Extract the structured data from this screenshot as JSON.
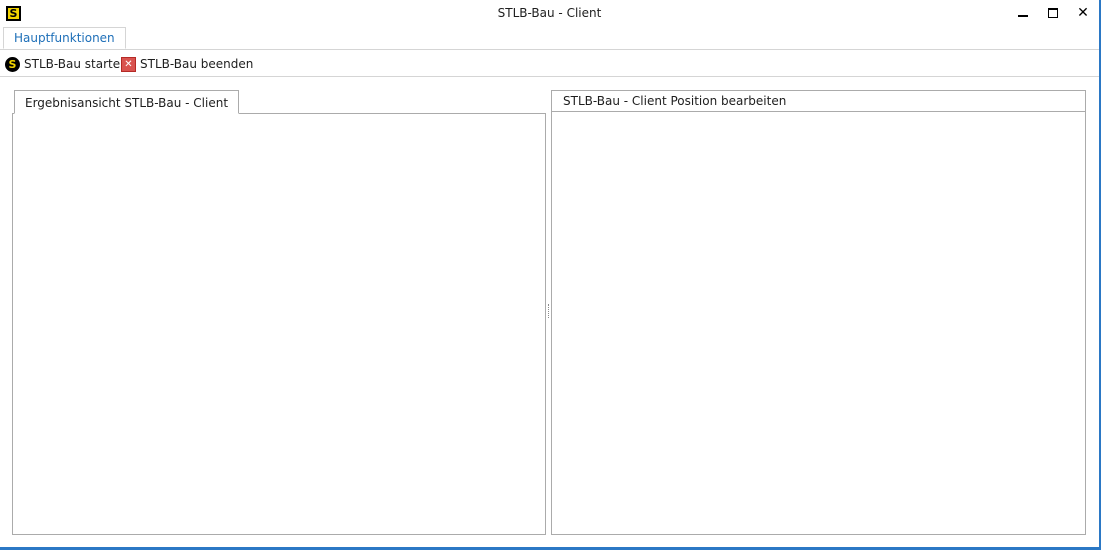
{
  "window": {
    "title": "STLB-Bau - Client",
    "app_icon_letter": "S",
    "controls": {
      "minimize": "minimize-icon",
      "maximize": "maximize-icon",
      "close": "close-icon"
    },
    "accent_color": "#2b78c5"
  },
  "ribbon": {
    "tabs": [
      {
        "label": "Hauptfunktionen",
        "selected": true
      }
    ],
    "toolbar": {
      "start_label": "STLB-Bau starten",
      "start_icon": "stlb-start-icon",
      "stop_label": "STLB-Bau beenden",
      "stop_icon": "stop-icon"
    }
  },
  "left_pane": {
    "tab_label": "Ergebnisansicht STLB-Bau - Client"
  },
  "right_pane": {
    "header": "STLB-Bau - Client Position bearbeiten"
  }
}
